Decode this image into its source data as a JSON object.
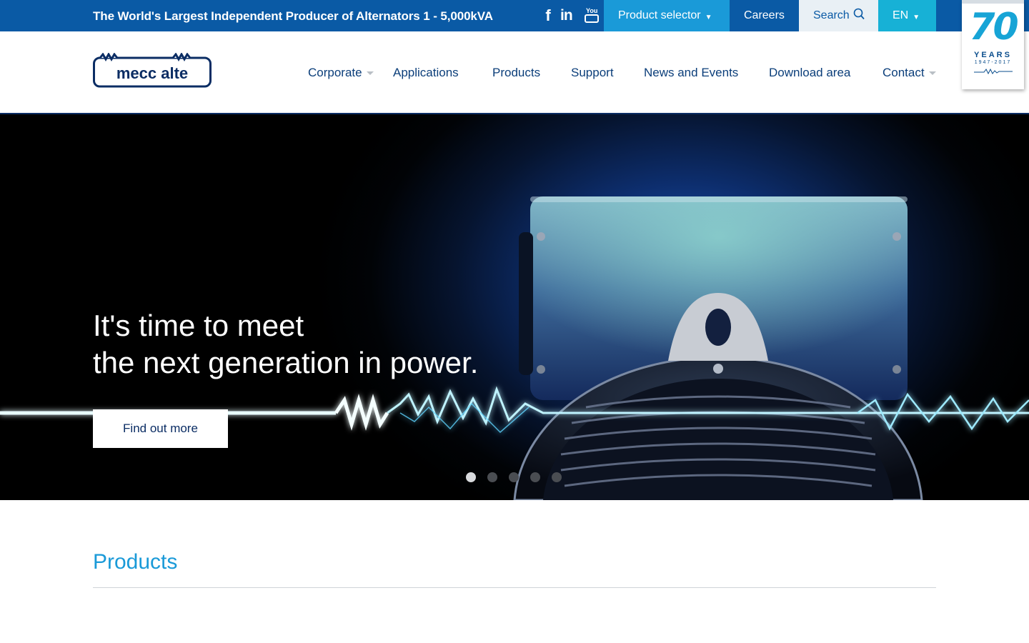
{
  "topbar": {
    "tagline": "The World's Largest Independent Producer of Alternators 1 - 5,000kVA",
    "social": [
      "facebook-icon",
      "linkedin-icon",
      "youtube-icon"
    ],
    "youtube_word": "You",
    "linkedin_text": "in",
    "facebook_text": "f",
    "product_selector": "Product selector",
    "careers": "Careers",
    "search": "Search",
    "language": "EN"
  },
  "badge": {
    "number": "70",
    "years": "YEARS",
    "dates": "1947-2017"
  },
  "header": {
    "logo_text": "mecc alte",
    "nav": [
      {
        "label": "Corporate",
        "has_dropdown": true
      },
      {
        "label": "Applications",
        "has_dropdown": false
      },
      {
        "label": "Products",
        "has_dropdown": false
      },
      {
        "label": "Support",
        "has_dropdown": false
      },
      {
        "label": "News and Events",
        "has_dropdown": false
      },
      {
        "label": "Download area",
        "has_dropdown": false
      },
      {
        "label": "Contact",
        "has_dropdown": true
      }
    ]
  },
  "hero": {
    "line1": "It's time to meet",
    "line2": "the next generation in power.",
    "cta": "Find out more",
    "slides_total": 5,
    "active_slide": 1
  },
  "section": {
    "title": "Products"
  },
  "colors": {
    "topbar": "#0a5aa5",
    "product_selector": "#1a9ad8",
    "language": "#17b1d6",
    "search_bg": "#e9f0f5",
    "nav_text": "#0b3e7a",
    "accent_title": "#1a9ad8"
  }
}
